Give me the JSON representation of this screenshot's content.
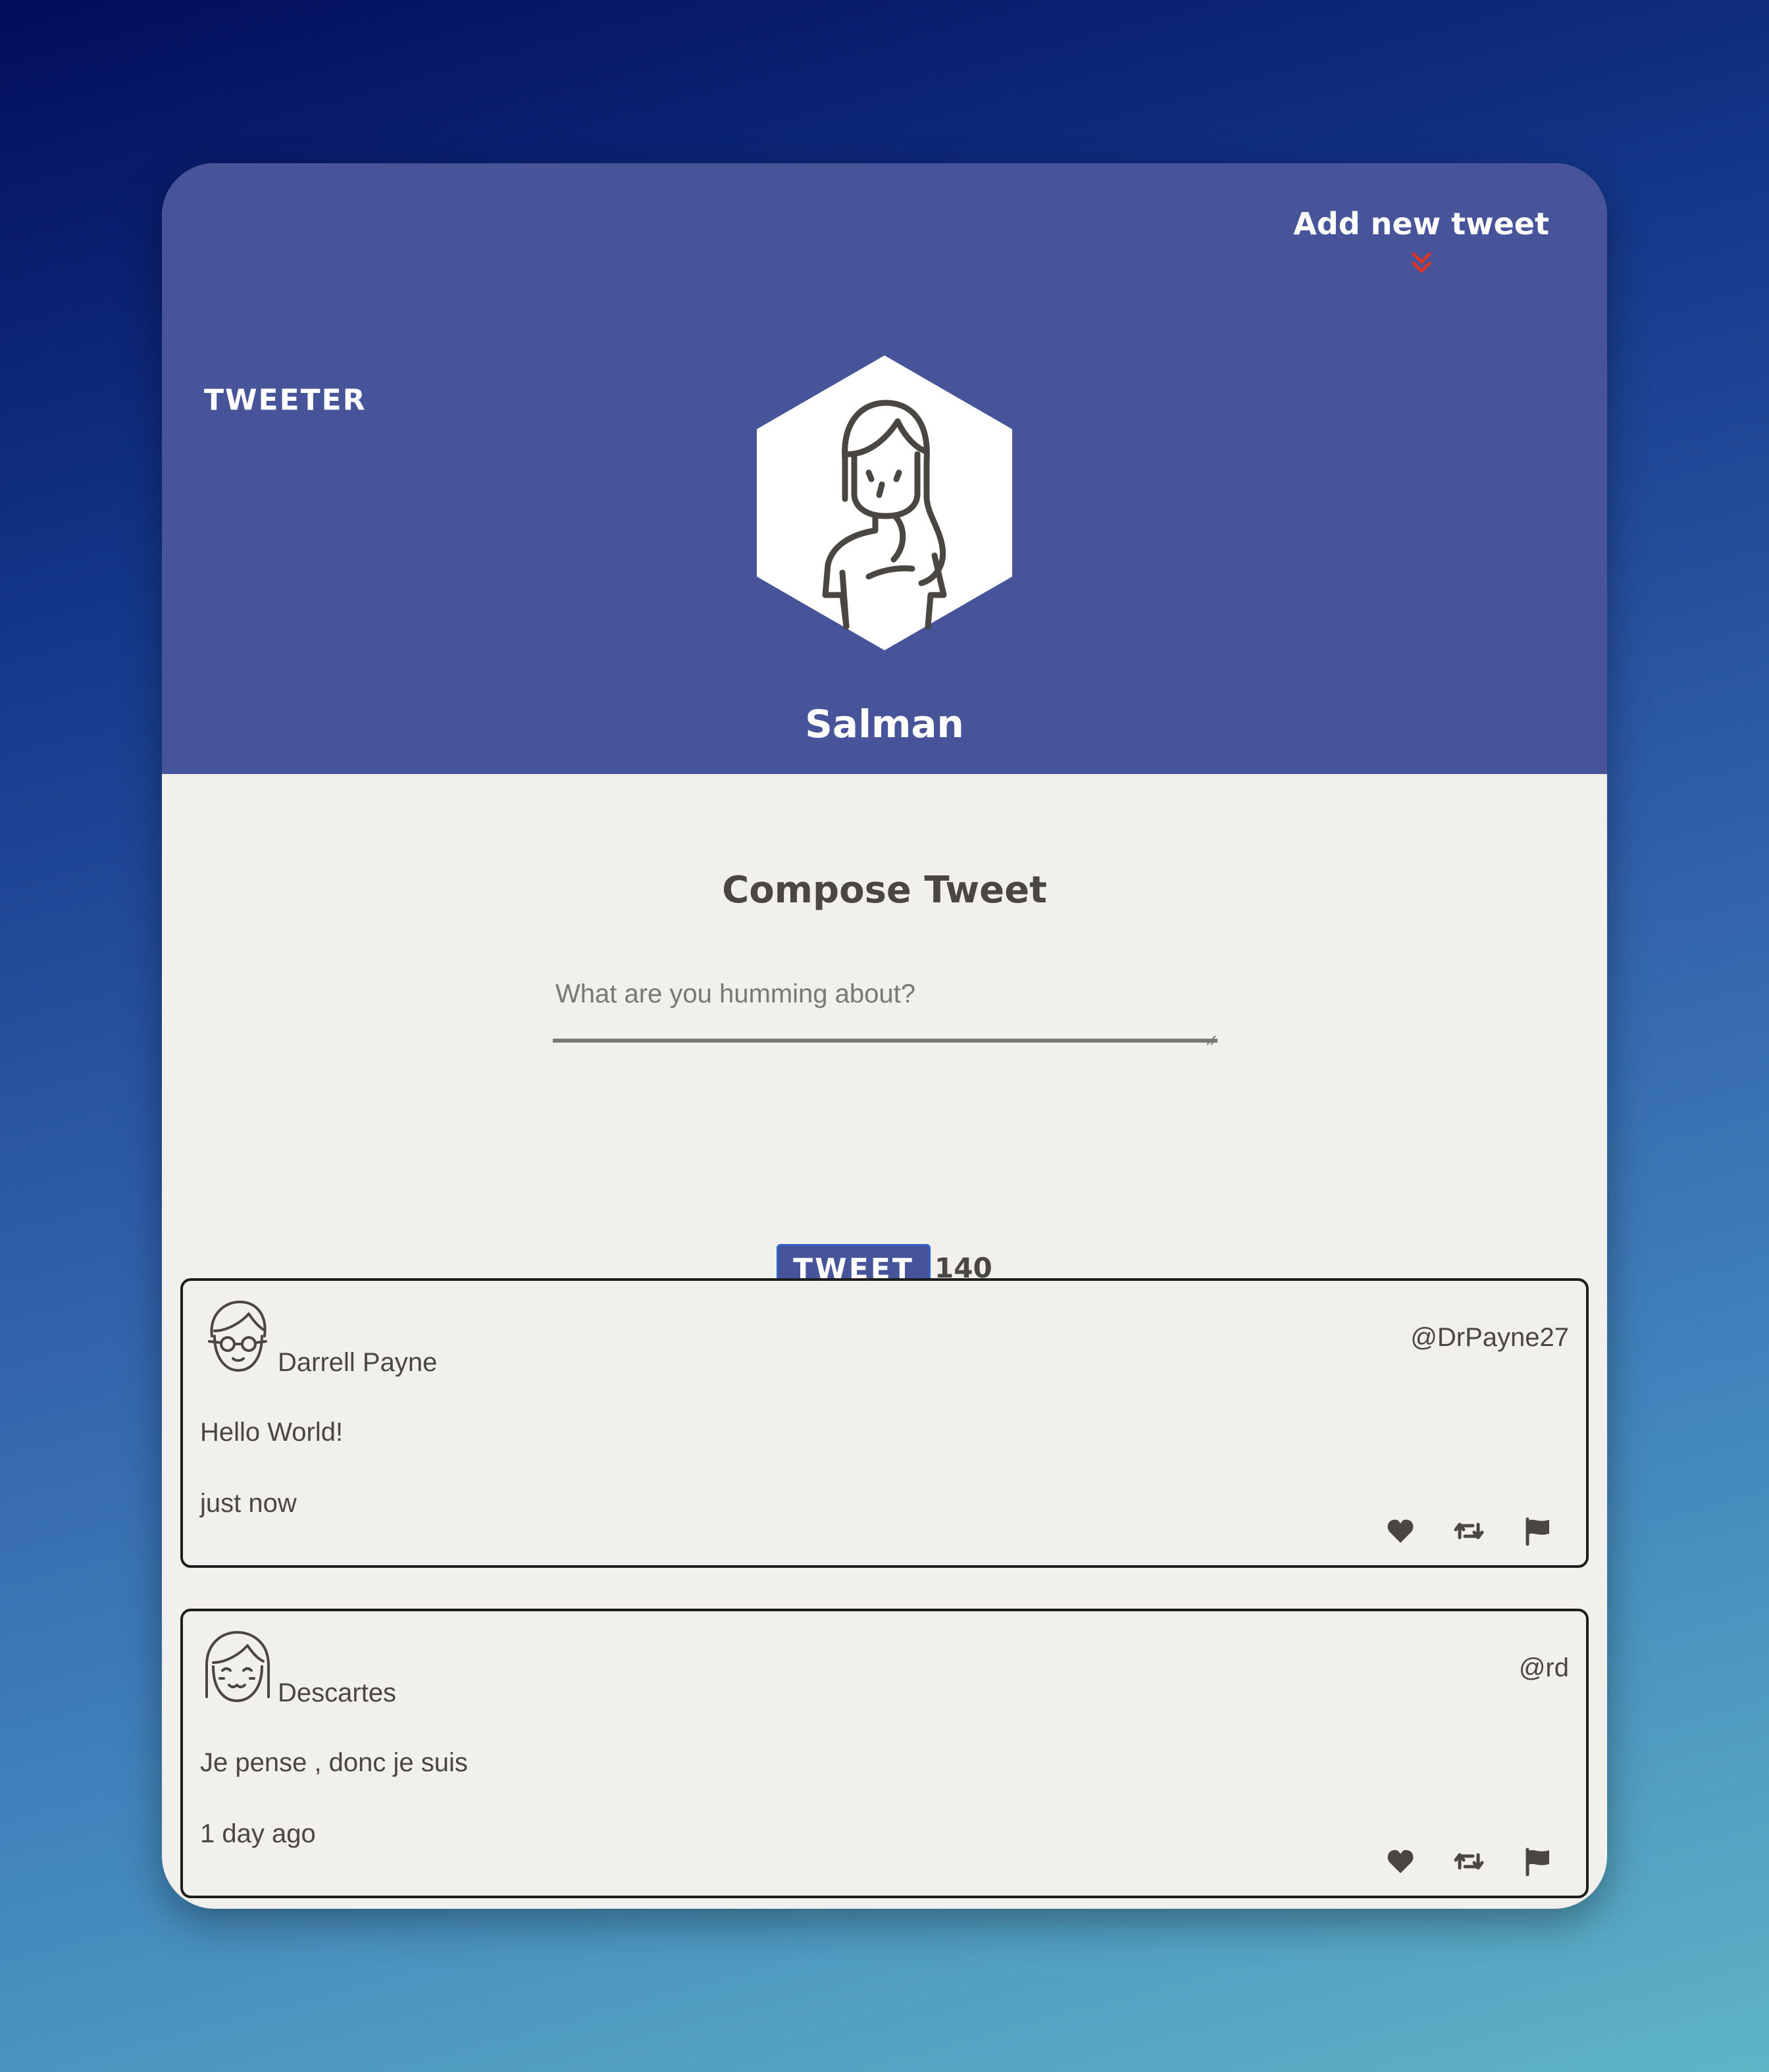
{
  "header": {
    "brand": "TWEETER",
    "add_new_tweet": "Add new tweet",
    "user_name": "Salman"
  },
  "compose": {
    "title": "Compose Tweet",
    "placeholder": "What are you humming about?",
    "value": "",
    "submit_label": "TWEET",
    "char_counter": "140"
  },
  "tweets": [
    {
      "name": "Darrell Payne",
      "handle": "@DrPayne27",
      "content": "Hello World!",
      "time": "just now"
    },
    {
      "name": "Descartes",
      "handle": "@rd",
      "content": "Je pense , donc je suis",
      "time": "1 day ago"
    }
  ],
  "colors": {
    "header_bg": "#47549a",
    "chevron": "#d9362b",
    "body_bg": "#f2f0ec",
    "text": "#4a4743"
  },
  "icons": {
    "add_tweet_chevron": "double-chevron-down-icon",
    "profile_avatar": "woman-avatar-icon",
    "tweet_actions": [
      "heart-icon",
      "retweet-icon",
      "flag-icon"
    ]
  }
}
